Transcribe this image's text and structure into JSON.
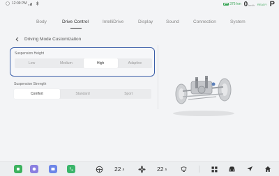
{
  "status": {
    "time": "12:09 PM",
    "battery_range": "376 km",
    "speed": "0",
    "speed_unit": "km/h",
    "ready": "READY",
    "gear": "P"
  },
  "tabs": [
    "Body",
    "Drive Control",
    "IntelliDrive",
    "Display",
    "Sound",
    "Connection",
    "System"
  ],
  "active_tab": "Drive Control",
  "breadcrumb": {
    "back_icon": "chevron-left-icon",
    "title": "Driving Mode Customization"
  },
  "suspension_height": {
    "label": "Suspension Height",
    "options": [
      "Low",
      "Medium",
      "High",
      "Adaptive"
    ],
    "selected": "High"
  },
  "suspension_strength": {
    "label": "Suspension Strength",
    "options": [
      "Comfort",
      "Standard",
      "Sport"
    ],
    "selected": "Comfort"
  },
  "dock": {
    "app_icons": [
      {
        "name": "green-app-icon",
        "color": "#3cb25e"
      },
      {
        "name": "purple-app-icon",
        "color": "#8a7fe0"
      },
      {
        "name": "blue-app-icon",
        "color": "#6d86e8"
      },
      {
        "name": "phone-app-icon",
        "color": "#3ab56a"
      }
    ],
    "left_temp": "22",
    "left_temp_unit": ".5",
    "right_temp": "22",
    "right_temp_unit": ".5"
  },
  "colors": {
    "accent": "#3a5ea8",
    "battery": "#3aa657"
  }
}
